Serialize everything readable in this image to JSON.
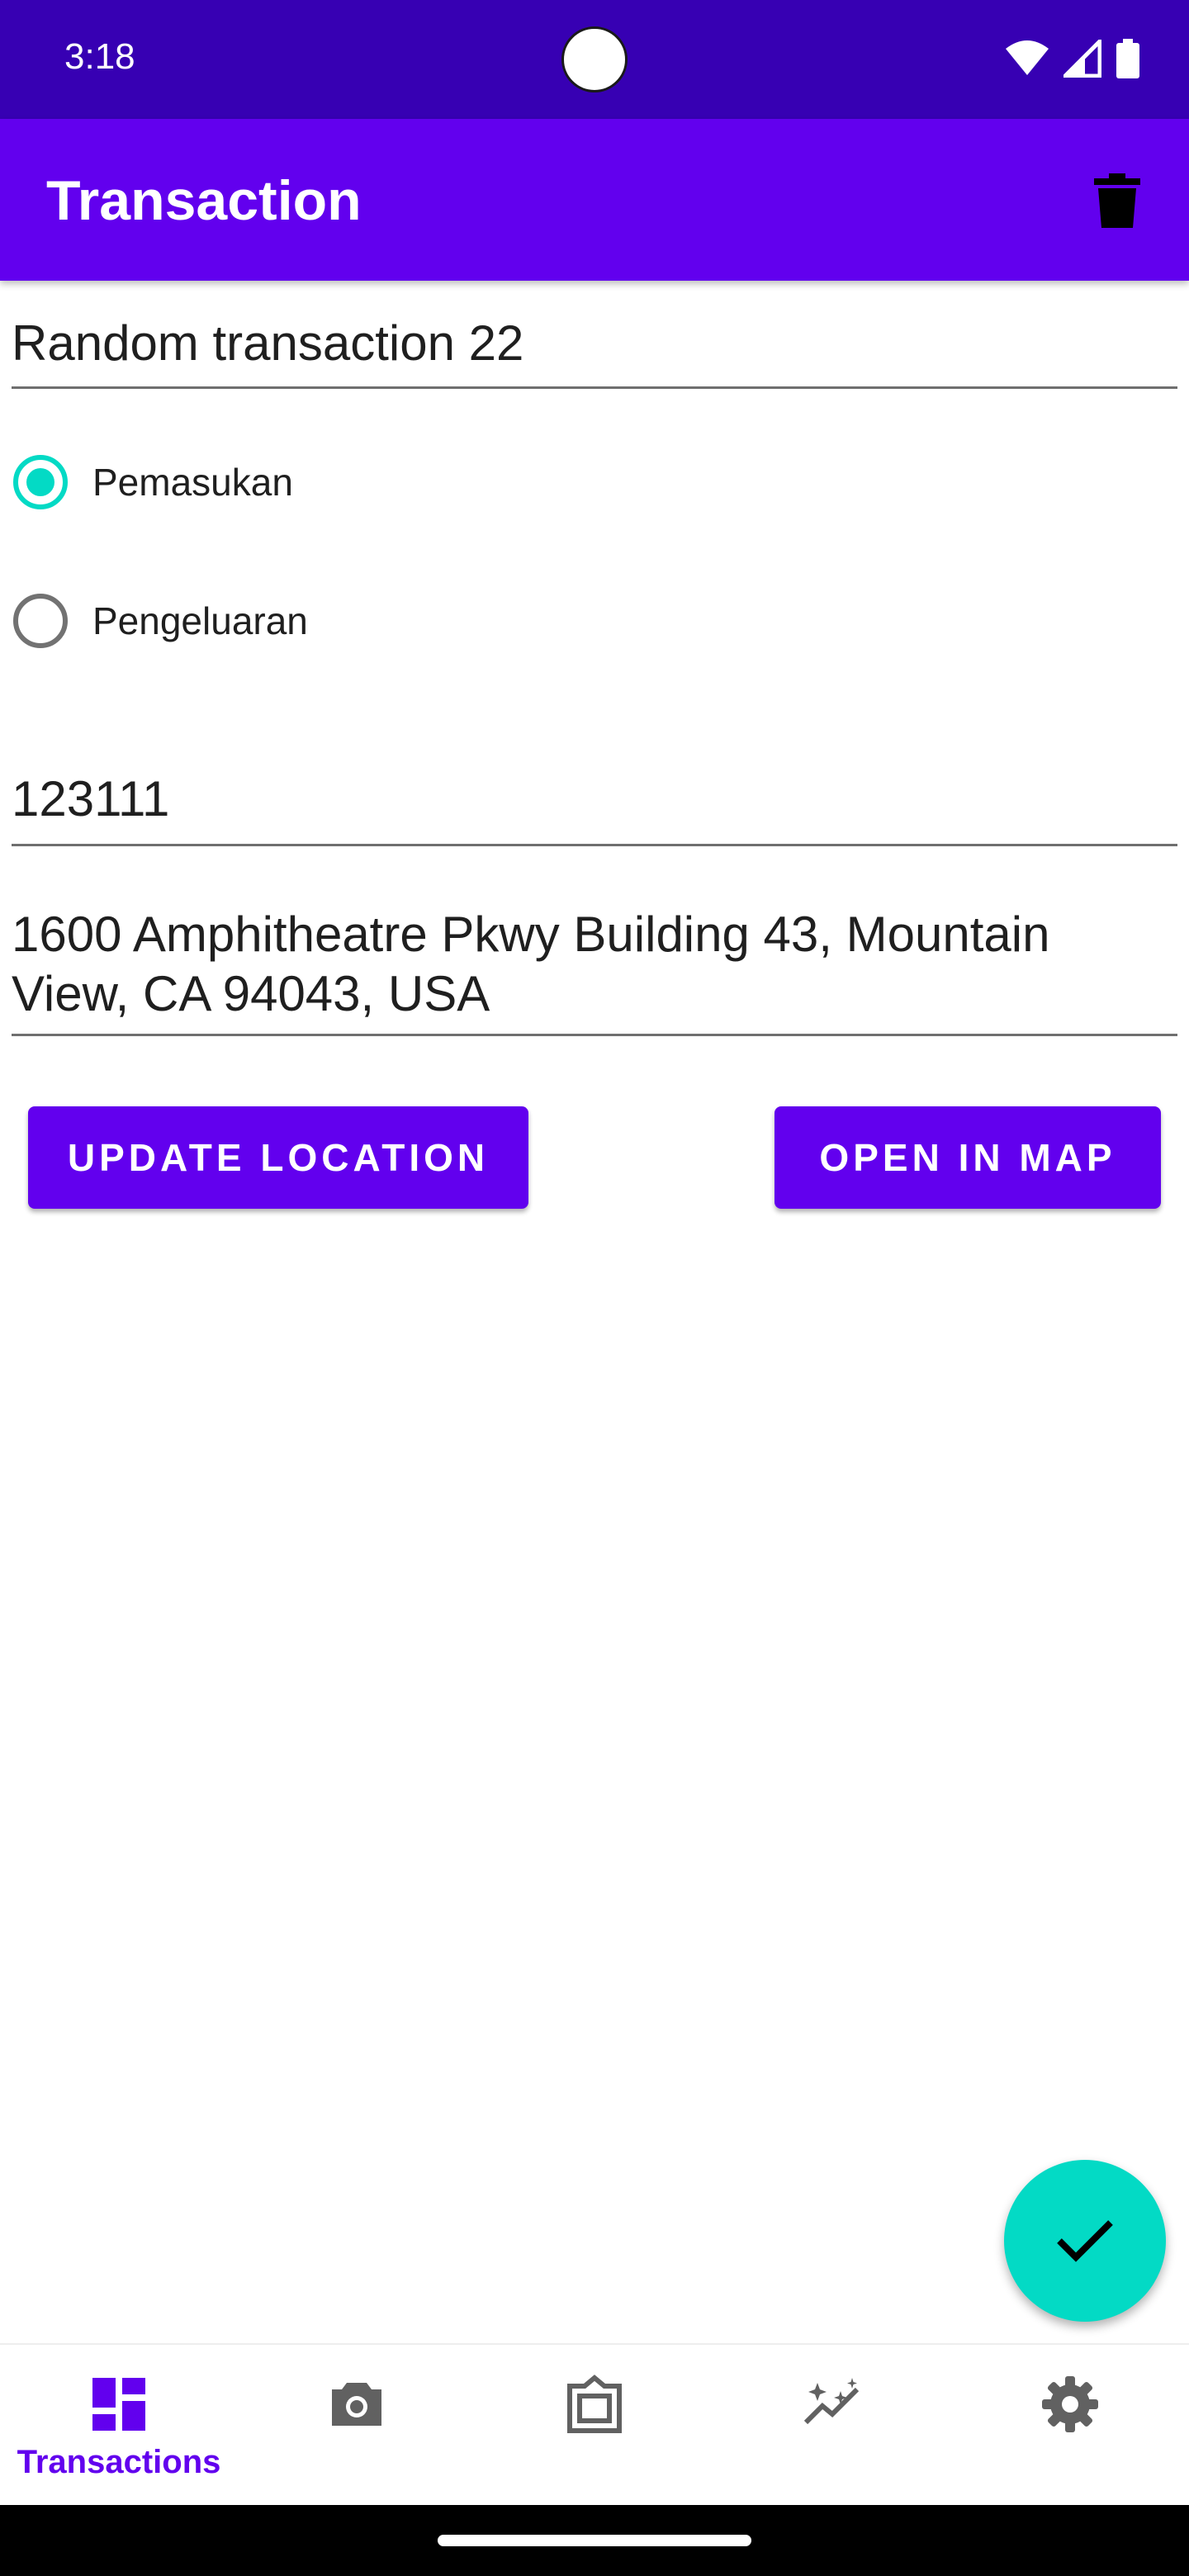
{
  "status_bar": {
    "time": "3:18"
  },
  "app_bar": {
    "title": "Transaction"
  },
  "form": {
    "name_value": "Random transaction 22",
    "type_options": [
      {
        "label": "Pemasukan",
        "checked": true
      },
      {
        "label": "Pengeluaran",
        "checked": false
      }
    ],
    "amount_value": "123111",
    "address_value": "1600 Amphitheatre Pkwy Building 43, Mountain View, CA 94043, USA"
  },
  "buttons": {
    "update_location": "UPDATE LOCATION",
    "open_in_map": "OPEN IN MAP"
  },
  "bottom_nav": {
    "items": [
      {
        "label": "Transactions",
        "icon": "dashboard-icon",
        "active": true
      },
      {
        "label": "",
        "icon": "camera-icon",
        "active": false
      },
      {
        "label": "",
        "icon": "gallery-icon",
        "active": false
      },
      {
        "label": "",
        "icon": "analytics-icon",
        "active": false
      },
      {
        "label": "",
        "icon": "settings-icon",
        "active": false
      }
    ]
  },
  "colors": {
    "primary": "#6200ee",
    "primary_dark": "#3700b3",
    "accent": "#03dac5"
  }
}
